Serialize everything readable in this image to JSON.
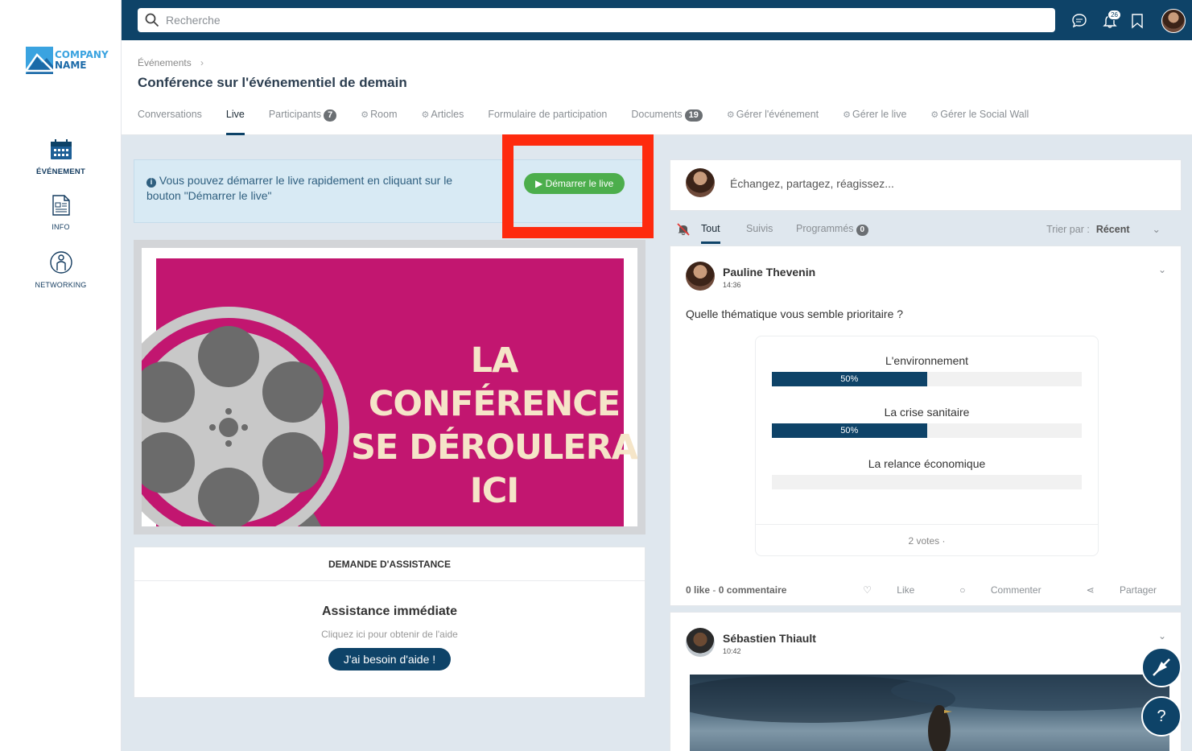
{
  "sidebar": {
    "logo": {
      "line1": "COMPANY",
      "line2": "NAME"
    },
    "items": [
      {
        "label": "ÉVÉNEMENT",
        "icon": "calendar-icon",
        "active": true
      },
      {
        "label": "INFO",
        "icon": "document-icon",
        "active": false
      },
      {
        "label": "NETWORKING",
        "icon": "person-icon",
        "active": false
      }
    ]
  },
  "topbar": {
    "search_placeholder": "Recherche",
    "notif_count": "26",
    "icons": [
      "chat-icon",
      "bell-icon",
      "bookmark-icon",
      "user-avatar"
    ]
  },
  "header": {
    "breadcrumb": "Événements",
    "title": "Conférence sur l'événementiel de demain",
    "tabs": [
      {
        "label": "Conversations"
      },
      {
        "label": "Live",
        "active": true
      },
      {
        "label": "Participants",
        "count": "7"
      },
      {
        "label": "Room",
        "gear": true
      },
      {
        "label": "Articles",
        "gear": true
      },
      {
        "label": "Formulaire de participation"
      },
      {
        "label": "Documents",
        "count": "19"
      },
      {
        "label": "Gérer l'événement",
        "gear": true
      },
      {
        "label": "Gérer le live",
        "gear": true
      },
      {
        "label": "Gérer le Social Wall",
        "gear": true
      }
    ]
  },
  "live": {
    "info_text": "Vous pouvez démarrer le live rapidement en cliquant sur le bouton \"Démarrer le live\"",
    "start_button": "Démarrer le live",
    "poster_lines": [
      "LA",
      "CONFÉRENCE",
      "SE DÉROULERA",
      "ICI"
    ]
  },
  "assistance": {
    "header": "DEMANDE D'ASSISTANCE",
    "title": "Assistance immédiate",
    "subtitle": "Cliquez ici pour obtenir de l'aide",
    "button": "J'ai besoin d'aide !"
  },
  "feed": {
    "compose_placeholder": "Échangez, partagez, réagissez...",
    "tabs": [
      {
        "label": "Tout",
        "active": true
      },
      {
        "label": "Suivis"
      },
      {
        "label": "Programmés",
        "count": "0"
      }
    ],
    "sort_label": "Trier par :",
    "sort_value": "Récent",
    "posts": [
      {
        "author": "Pauline Thevenin",
        "time": "14:36",
        "question": "Quelle thématique vous semble prioritaire ?",
        "poll": [
          {
            "label": "L'environnement",
            "percent": 50,
            "percent_label": "50%"
          },
          {
            "label": "La crise sanitaire",
            "percent": 50,
            "percent_label": "50%"
          },
          {
            "label": "La relance économique",
            "percent": 0,
            "percent_label": ""
          }
        ],
        "votes": "2 votes ·",
        "likes": "0 like",
        "comments": "0 commentaire",
        "actions": [
          "Like",
          "Commenter",
          "Partager"
        ]
      },
      {
        "author": "Sébastien Thiault",
        "time": "10:42"
      }
    ]
  },
  "fab": {
    "help_label": "?"
  },
  "colors": {
    "primary": "#0e4368",
    "success": "#4cae4c",
    "highlight": "#fe2a0e",
    "poster": "#c21670"
  }
}
